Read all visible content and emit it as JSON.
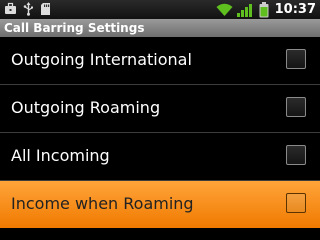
{
  "status_bar": {
    "left_icons": [
      "briefcase-icon",
      "usb-icon",
      "sd-card-icon"
    ],
    "right_icons": [
      "wifi-icon",
      "signal-icon",
      "battery-icon"
    ],
    "time": "10:37"
  },
  "title_bar": {
    "title": "Call Barring Settings"
  },
  "settings": {
    "items": [
      {
        "label": "Outgoing International",
        "checked": false,
        "selected": false
      },
      {
        "label": "Outgoing Roaming",
        "checked": false,
        "selected": false
      },
      {
        "label": "All Incoming",
        "checked": false,
        "selected": false
      },
      {
        "label": "Income when Roaming",
        "checked": false,
        "selected": true
      }
    ]
  }
}
